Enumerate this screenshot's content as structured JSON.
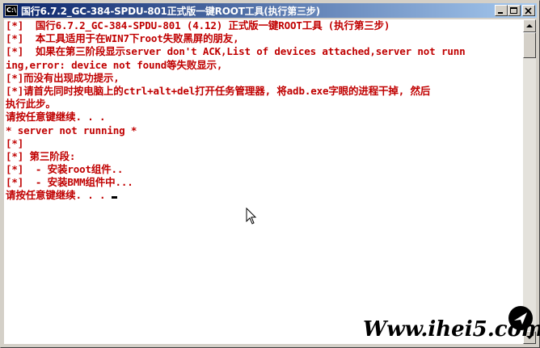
{
  "window": {
    "icon_label": "C:\\",
    "title": "国行6.7.2_GC-384-SPDU-801正式版一键ROOT工具(执行第三步)"
  },
  "console": {
    "lines": [
      {
        "text": "[*]  国行6.7.2_GC-384-SPDU-801 (4.12) 正式版一键ROOT工具 (执行第三步)",
        "color": "red"
      },
      {
        "text": "[*]  本工具适用于在WIN7下root失败黑屏的朋友,",
        "color": "red"
      },
      {
        "text": "[*]  如果在第三阶段显示server don't ACK,List of devices attached,server not runn",
        "color": "red"
      },
      {
        "text": "ing,error: device not found等失败显示,",
        "color": "red"
      },
      {
        "text": "[*]而没有出现成功提示,",
        "color": "red"
      },
      {
        "text": "[*]请首先同时按电脑上的ctrl+alt+del打开任务管理器, 将adb.exe字眼的进程干掉, 然后",
        "color": "red"
      },
      {
        "text": "执行此步。",
        "color": "red"
      },
      {
        "text": "请按任意键继续. . .",
        "color": "red"
      },
      {
        "text": "* server not running *",
        "color": "red"
      },
      {
        "text": "[*]",
        "color": "red"
      },
      {
        "text": "[*] 第三阶段:",
        "color": "red"
      },
      {
        "text": "[*]  - 安装root组件..",
        "color": "red"
      },
      {
        "text": "[*]  - 安装BMM组件中...",
        "color": "red"
      },
      {
        "text": "请按任意键继续. . .",
        "color": "red"
      }
    ]
  },
  "watermark": {
    "text": "Www.ihei5.com"
  },
  "colors": {
    "console_text": "#c00000",
    "title_gradient_start": "#0a246a",
    "title_gradient_end": "#a6caf0"
  }
}
